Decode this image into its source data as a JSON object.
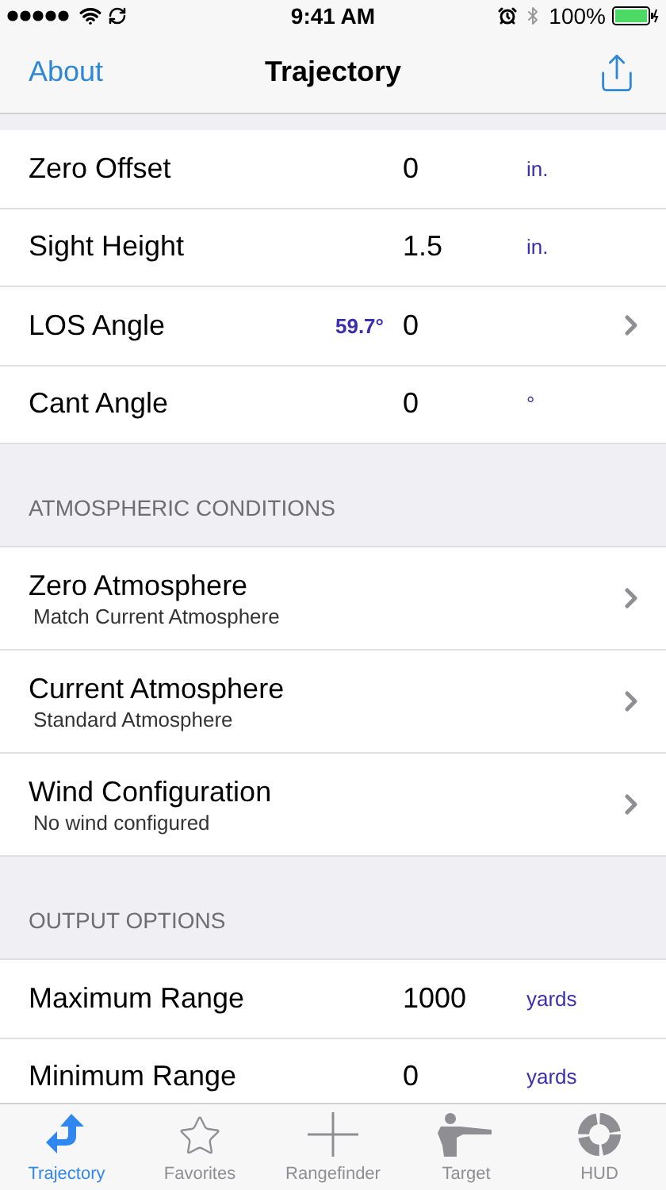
{
  "status_bar": {
    "time": "9:41 AM",
    "battery": "100%"
  },
  "nav": {
    "back": "About",
    "title": "Trajectory"
  },
  "sections": [
    {
      "rows": [
        {
          "kind": "field",
          "label": "Zero Offset",
          "value": "0",
          "unit": "in.",
          "disclosure": false
        },
        {
          "kind": "field",
          "label": "Sight Height",
          "value": "1.5",
          "unit": "in.",
          "disclosure": false
        },
        {
          "kind": "field",
          "label": "LOS Angle",
          "note": "59.7°",
          "value": "0",
          "disclosure": true
        },
        {
          "kind": "field",
          "label": "Cant Angle",
          "value": "0",
          "unit": "°",
          "disclosure": false
        }
      ]
    },
    {
      "header": "ATMOSPHERIC CONDITIONS",
      "rows": [
        {
          "kind": "link",
          "label": "Zero Atmosphere",
          "subtitle": "Match Current Atmosphere",
          "disclosure": true
        },
        {
          "kind": "link",
          "label": "Current Atmosphere",
          "subtitle": "Standard Atmosphere",
          "disclosure": true
        },
        {
          "kind": "link",
          "label": "Wind Configuration",
          "subtitle": "No wind configured",
          "disclosure": true
        }
      ]
    },
    {
      "header": "OUTPUT OPTIONS",
      "rows": [
        {
          "kind": "field",
          "label": "Maximum Range",
          "value": "1000",
          "unit": "yards",
          "disclosure": false
        },
        {
          "kind": "field",
          "label": "Minimum Range",
          "value": "0",
          "unit": "yards",
          "disclosure": false
        }
      ]
    }
  ],
  "tabs": [
    {
      "kind": "trajectory",
      "label": "Trajectory",
      "selected": true
    },
    {
      "kind": "favorites",
      "label": "Favorites",
      "selected": false
    },
    {
      "kind": "rangefinder",
      "label": "Rangefinder",
      "selected": false
    },
    {
      "kind": "target",
      "label": "Target",
      "selected": false
    },
    {
      "kind": "hud",
      "label": "HUD",
      "selected": false
    }
  ]
}
